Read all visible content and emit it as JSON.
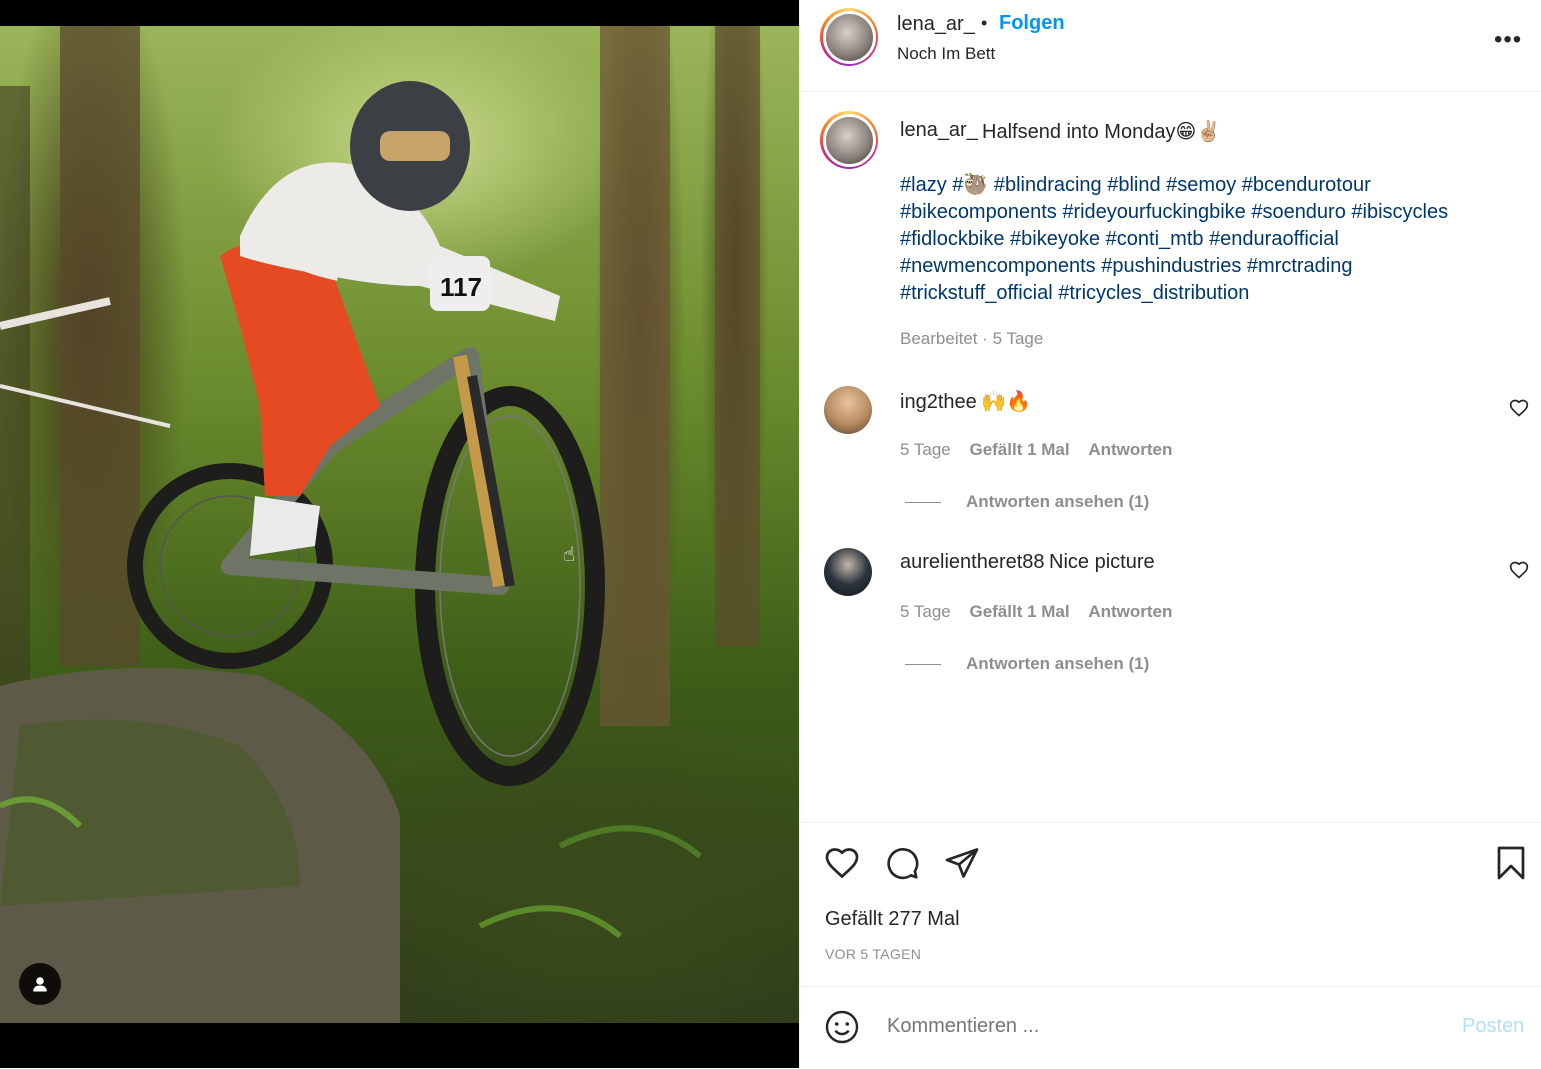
{
  "post": {
    "author": "lena_ar_",
    "follow_separator": "•",
    "follow_label": "Folgen",
    "location": "Noch Im Bett",
    "more_label": "•••",
    "caption": "Halfsend into Monday😁✌🏼",
    "hashtags": [
      "#lazy #🦥 #blindracing #blind #semoy #bcendurotour",
      "#bikecomponents #rideyourfuckingbike #soenduro #ibiscycles",
      "#fidlockbike #bikeyoke #conti_mtb #enduraofficial",
      "#newmencomponents #pushindustries #mrctrading",
      "#trickstuff_official #tricycles_distribution"
    ],
    "edited_label": "Bearbeitet · 5 Tage"
  },
  "comments": [
    {
      "user": "ing2thee",
      "text": "🙌🔥",
      "age": "5 Tage",
      "likes": "Gefällt 1 Mal",
      "reply": "Antworten",
      "view_replies": "Antworten ansehen (1)",
      "avatar_color": "#c9a27a"
    },
    {
      "user": "aurelientheret88",
      "text": "Nice picture",
      "age": "5 Tage",
      "likes": "Gefällt 1 Mal",
      "reply": "Antworten",
      "view_replies": "Antworten ansehen (1)",
      "avatar_color": "#1f2a33"
    }
  ],
  "footer": {
    "likes_label": "Gefällt 277 Mal",
    "time_label": "VOR 5 TAGEN",
    "comment_placeholder": "Kommentieren ...",
    "post_label": "Posten"
  },
  "icons": {
    "like": "heart-icon",
    "comment": "comment-bubble-icon",
    "share": "paper-plane-icon",
    "save": "bookmark-icon",
    "emoji": "smiley-icon",
    "user_tag": "person-icon",
    "more": "ellipsis-icon"
  },
  "colors": {
    "link_blue": "#0095f6",
    "hashtag_blue": "#00376b",
    "muted": "#8e8e8e",
    "post_disabled": "#b2dffc"
  }
}
